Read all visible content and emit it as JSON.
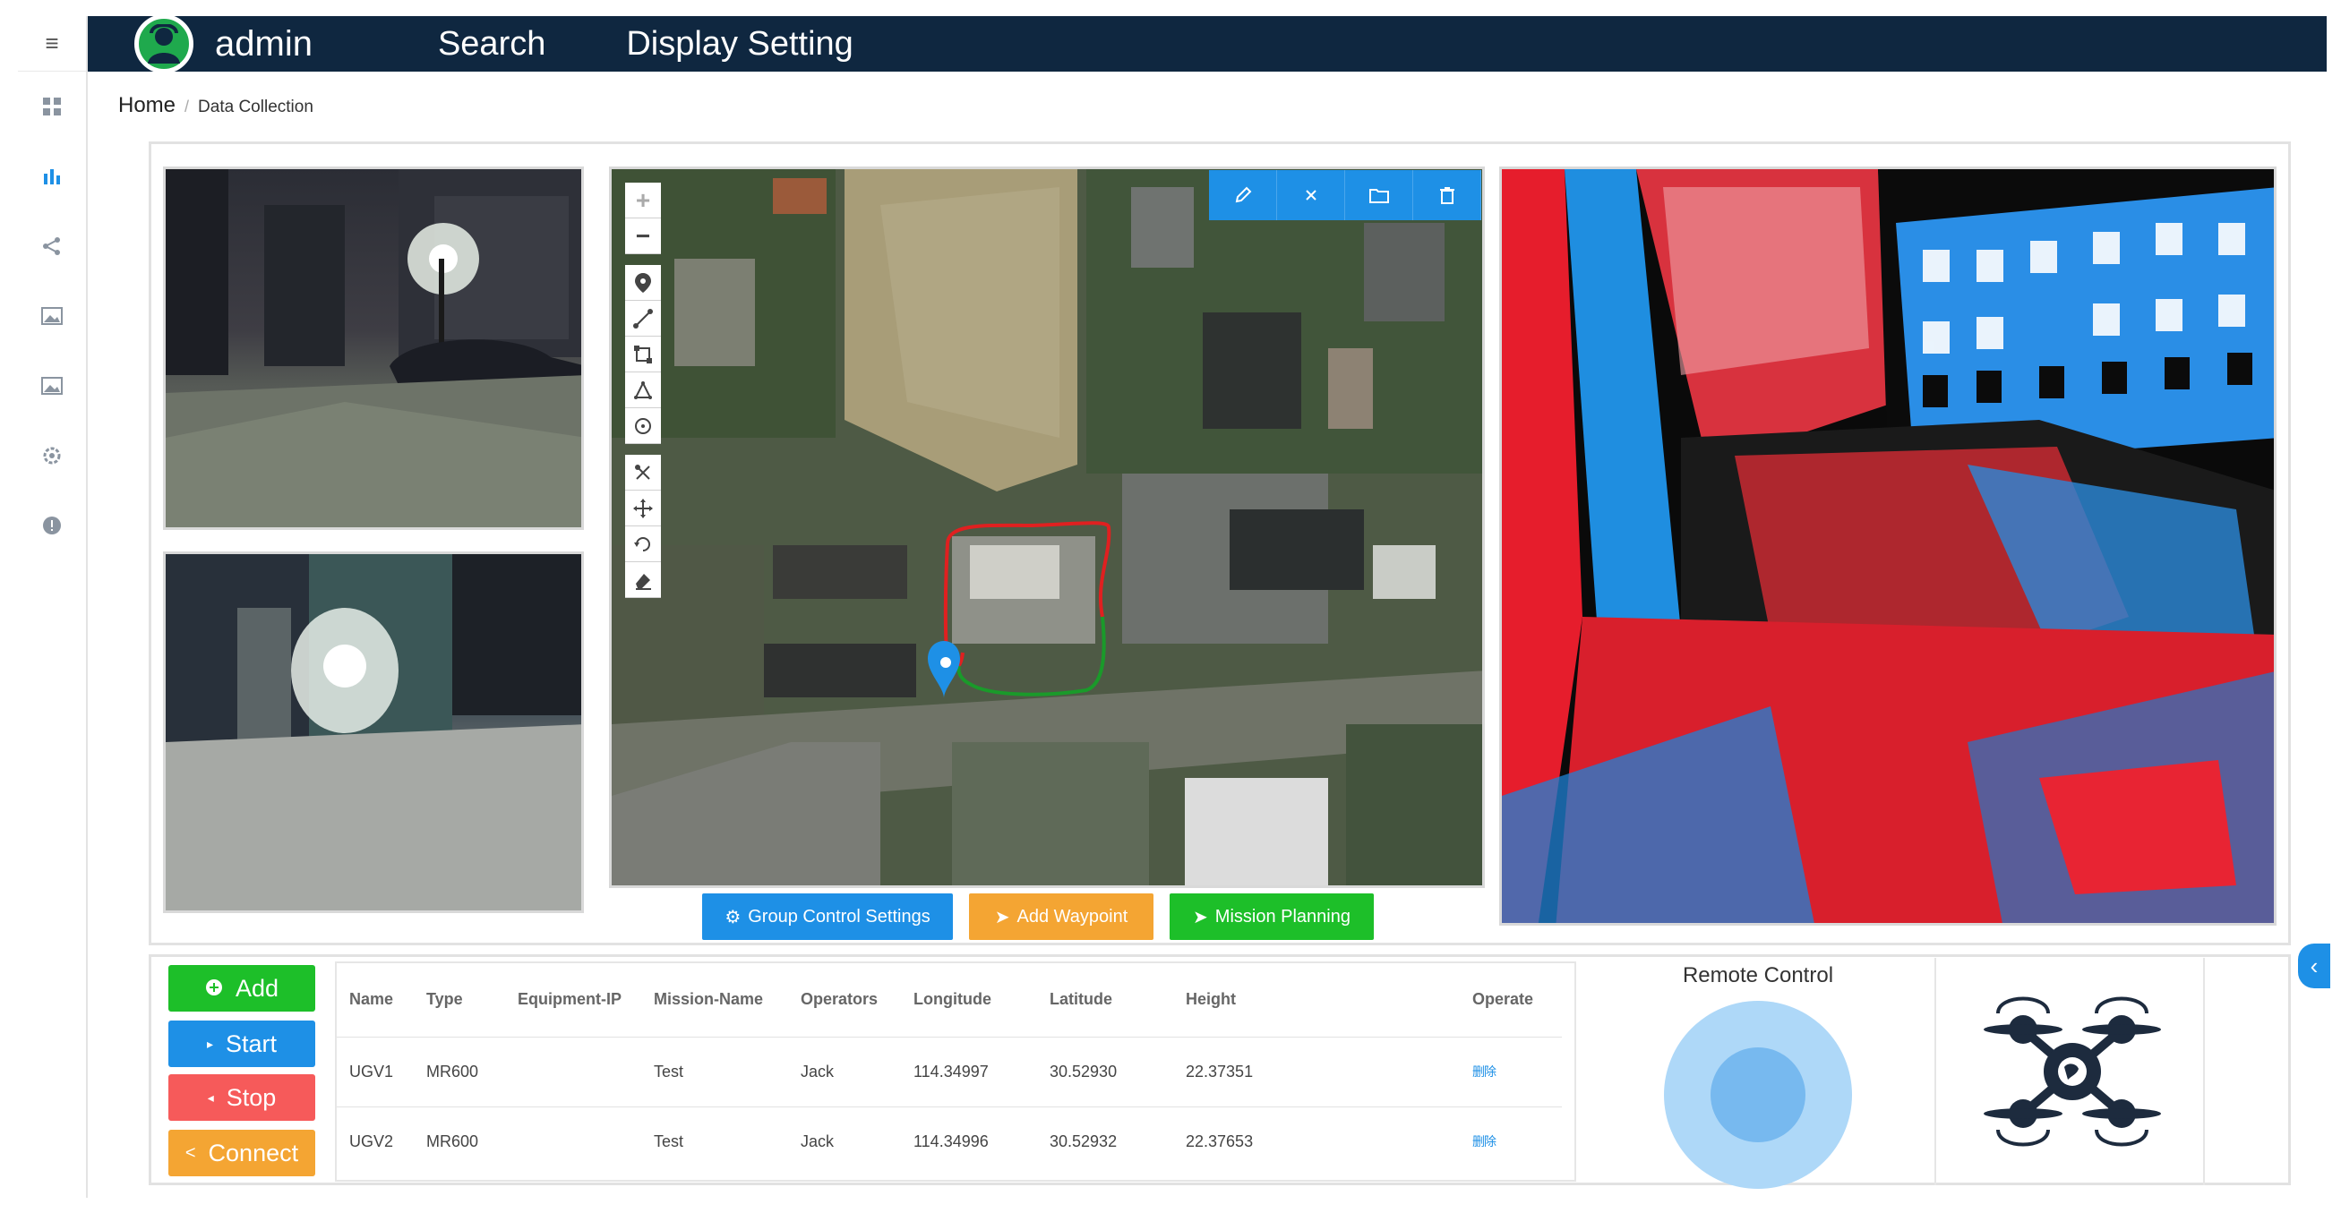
{
  "header": {
    "user": "admin",
    "nav": [
      "Search",
      "Display Setting"
    ]
  },
  "sidebar": {
    "menu_icon": "hamburger-icon",
    "items": [
      "dashboard-icon",
      "bar-chart-icon",
      "share-icon",
      "image-icon",
      "image-icon",
      "gear-icon",
      "info-icon"
    ]
  },
  "breadcrumb": {
    "home": "Home",
    "separator": "/",
    "current": "Data Collection"
  },
  "map_actions": {
    "group_control": "Group Control Settings",
    "add_waypoint": "Add Waypoint",
    "mission_planning": "Mission Planning"
  },
  "controls": {
    "add": "Add",
    "start": "Start",
    "stop": "Stop",
    "connect": "Connect"
  },
  "table": {
    "headers": [
      "Name",
      "Type",
      "Equipment-IP",
      "Mission-Name",
      "Operators",
      "Longitude",
      "Latitude",
      "Height",
      "Operate"
    ],
    "rows": [
      [
        "UGV1",
        "MR600",
        "",
        "Test",
        "Jack",
        "114.34997",
        "30.52930",
        "22.37351",
        "删除"
      ],
      [
        "UGV2",
        "MR600",
        "",
        "Test",
        "Jack",
        "114.34996",
        "30.52932",
        "22.37653",
        "删除"
      ]
    ]
  },
  "remote_control": {
    "title": "Remote Control"
  },
  "colors": {
    "topbar": "#0f2740",
    "green": "#1dbf29",
    "blue": "#1e90e6",
    "red": "#f65a5a",
    "orange": "#f4a533",
    "track_red": "#e02020",
    "track_green": "#1a9a2a"
  }
}
